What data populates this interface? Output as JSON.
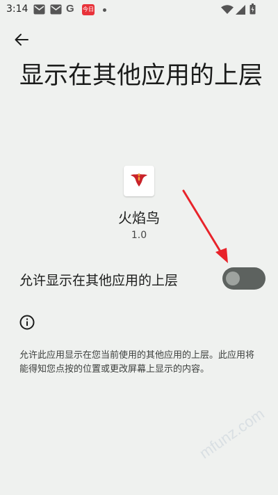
{
  "status_bar": {
    "time": "3:14",
    "icons": [
      "mail-icon",
      "mail-icon",
      "google-icon",
      "app-notification-icon",
      "dot-icon",
      "wifi-icon",
      "signal-icon",
      "battery-icon"
    ],
    "google_glyph": "G",
    "app_badge_text": "今日"
  },
  "header": {
    "back_icon": "arrow-left-icon",
    "title": "显示在其他应用的上层"
  },
  "app": {
    "name": "火焰鸟",
    "version": "1.0",
    "icon": "phoenix-icon"
  },
  "permission": {
    "label": "允许显示在其他应用的上层",
    "enabled": false
  },
  "info": {
    "icon": "info-icon",
    "description": "允许此应用显示在您当前使用的其他应用的上层。此应用将能得知您点按的位置或更改屏幕上显示的内容。"
  },
  "colors": {
    "background": "#eff1ef",
    "toggle_track": "#5d625f",
    "toggle_thumb": "#9ea39f",
    "arrow": "#e8232a"
  },
  "watermark": "mfunz.com"
}
